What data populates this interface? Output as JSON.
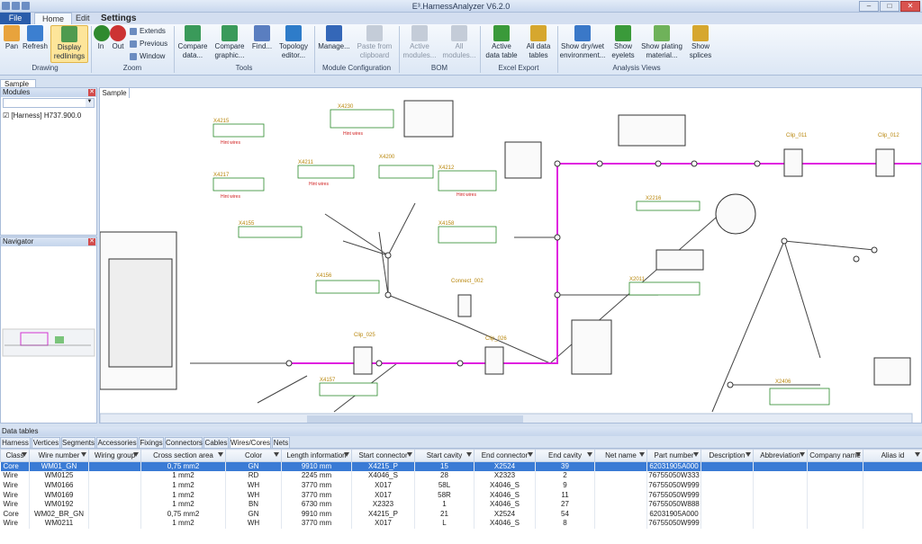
{
  "app": {
    "title": "E³.HarnessAnalyzer V6.2.0"
  },
  "menu": {
    "file": "File",
    "home": "Home",
    "edit": "Edit",
    "settings": "Settings"
  },
  "ribbon": {
    "pan": "Pan",
    "refresh": "Refresh",
    "display_redlinings_1": "Display",
    "display_redlinings_2": "redlinings",
    "zoom_in": "In",
    "zoom_out": "Out",
    "extends": "Extends",
    "previous": "Previous",
    "window": "Window",
    "compare_data_1": "Compare",
    "compare_data_2": "data...",
    "compare_graphic_1": "Compare",
    "compare_graphic_2": "graphic...",
    "find": "Find...",
    "topology_1": "Topology",
    "topology_2": "editor...",
    "manage": "Manage...",
    "paste_1": "Paste from",
    "paste_2": "clipboard",
    "active_modules_1": "Active",
    "active_modules_2": "modules...",
    "all_modules_1": "All",
    "all_modules_2": "modules...",
    "active_data_1": "Active",
    "active_data_2": "data table",
    "all_data_1": "All data",
    "all_data_2": "tables",
    "dry_wet_1": "Show dry/wet",
    "dry_wet_2": "environment...",
    "eyelets_1": "Show",
    "eyelets_2": "eyelets",
    "plating_1": "Show plating",
    "plating_2": "material...",
    "splices_1": "Show",
    "splices_2": "splices",
    "groups": {
      "drawing": "Drawing",
      "zoom": "Zoom",
      "tools": "Tools",
      "module_config": "Module Configuration",
      "bom": "BOM",
      "excel": "Excel Export",
      "analysis": "Analysis Views"
    }
  },
  "doc_tab": "Sample",
  "modules_panel": {
    "title": "Modules",
    "tree_item": "[Harness] H737.900.0"
  },
  "navigator_panel": {
    "title": "Navigator"
  },
  "canvas_tab": "Sample",
  "drawing": {
    "labels": [
      "X4215",
      "X4230",
      "X4217",
      "X4200",
      "X4211",
      "X4212",
      "X4158",
      "X4155",
      "X4156",
      "Clip_011",
      "Clip_012",
      "Clip_025",
      "Clip_026",
      "Connect_002",
      "X2216",
      "X2011",
      "X2406",
      "X4157"
    ],
    "hint": "Hint wires"
  },
  "data_tables": {
    "title": "Data tables",
    "tabs": [
      "Harness",
      "Vertices",
      "Segments",
      "Accessories",
      "Fixings",
      "Connectors",
      "Cables",
      "Wires/Cores",
      "Nets"
    ],
    "active_tab": "Wires/Cores",
    "columns": [
      "Class",
      "Wire number",
      "Wiring group",
      "Cross section area",
      "Color",
      "Length information",
      "Start connector",
      "Start cavity",
      "End connector",
      "End cavity",
      "Net name",
      "Part number",
      "Description",
      "Abbreviation",
      "Company name",
      "Alias id"
    ],
    "rows": [
      [
        "Core",
        "WM01_GN",
        "",
        "0,75 mm2",
        "GN",
        "9910 mm",
        "X4215_P",
        "15",
        "X2524",
        "39",
        "",
        "62031905A000",
        "",
        "",
        "",
        ""
      ],
      [
        "Wire",
        "WM0125",
        "",
        "1 mm2",
        "RD",
        "2245 mm",
        "X4046_S",
        "28",
        "X2323",
        "2",
        "",
        "76755050W333",
        "",
        "",
        "",
        ""
      ],
      [
        "Wire",
        "WM0166",
        "",
        "1 mm2",
        "WH",
        "3770 mm",
        "X017",
        "58L",
        "X4046_S",
        "9",
        "",
        "76755050W999",
        "",
        "",
        "",
        ""
      ],
      [
        "Wire",
        "WM0169",
        "",
        "1 mm2",
        "WH",
        "3770 mm",
        "X017",
        "58R",
        "X4046_S",
        "11",
        "",
        "76755050W999",
        "",
        "",
        "",
        ""
      ],
      [
        "Wire",
        "WM0192",
        "",
        "1 mm2",
        "BN",
        "6730 mm",
        "X2323",
        "1",
        "X4046_S",
        "27",
        "",
        "76755050W888",
        "",
        "",
        "",
        ""
      ],
      [
        "Core",
        "WM02_BR_GN",
        "",
        "0,75 mm2",
        "GN",
        "9910 mm",
        "X4215_P",
        "21",
        "X2524",
        "54",
        "",
        "62031905A000",
        "",
        "",
        "",
        ""
      ],
      [
        "Wire",
        "WM0211",
        "",
        "1 mm2",
        "WH",
        "3770 mm",
        "X017",
        "L",
        "X4046_S",
        "8",
        "",
        "76755050W999",
        "",
        "",
        "",
        ""
      ]
    ]
  }
}
